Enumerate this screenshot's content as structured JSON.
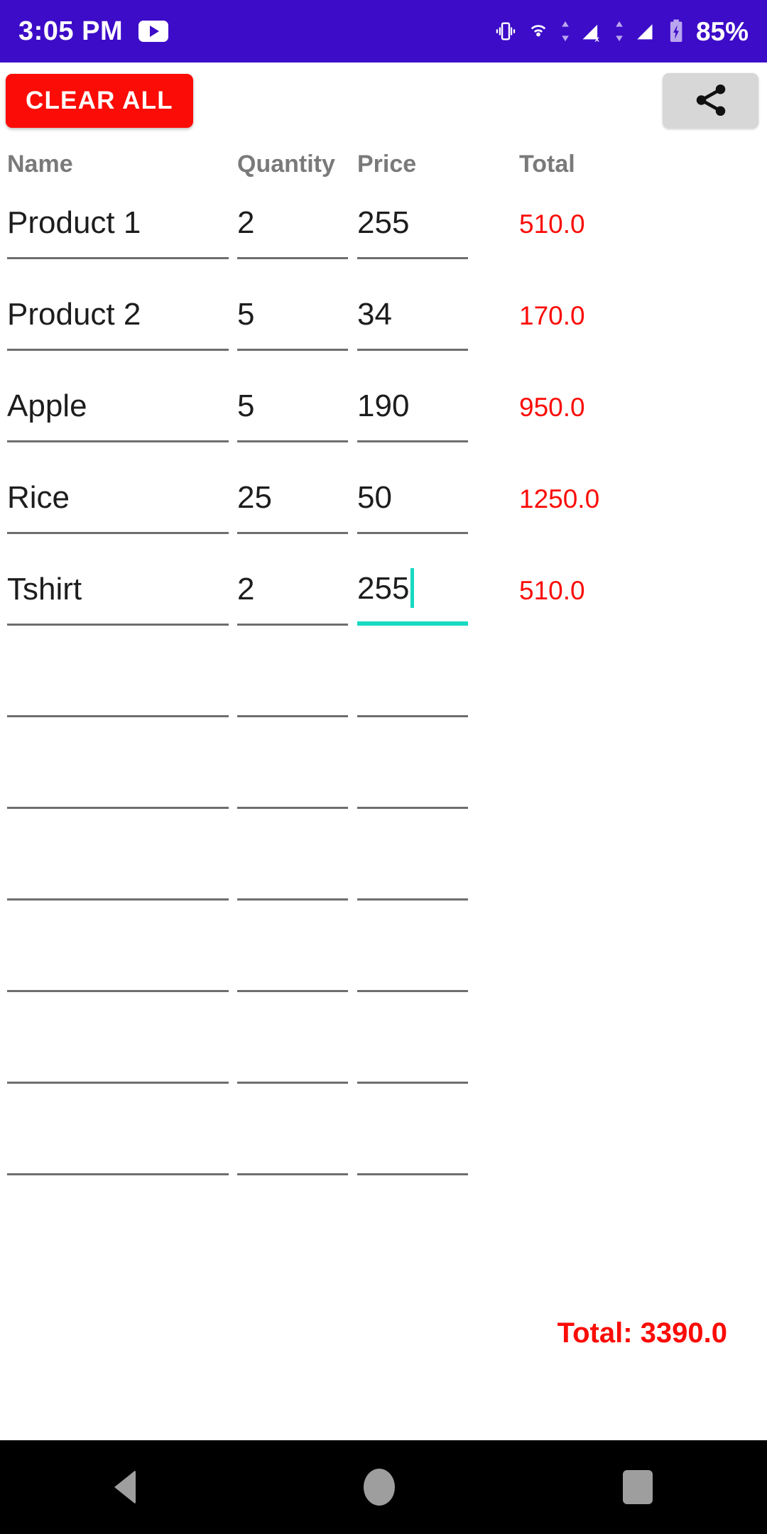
{
  "statusbar": {
    "time": "3:05 PM",
    "app_icon": "youtube-icon",
    "icons": [
      "vibrate-icon",
      "cast-icon",
      "data-transfer-icon",
      "signal-no-service-icon",
      "signal-bars-icon",
      "battery-charging-icon"
    ],
    "battery": "85%",
    "background_color": "#3d0cc8"
  },
  "toolbar": {
    "clear_label": "CLEAR ALL",
    "clear_color": "#fb0c06",
    "share_icon": "share-icon",
    "share_background": "#d7d7d7"
  },
  "table": {
    "headers": {
      "name": "Name",
      "quantity": "Quantity",
      "price": "Price",
      "total": "Total"
    },
    "header_color": "#7a7a7a",
    "total_color": "#fb0c06",
    "focus_color": "#18d9c2",
    "rows": [
      {
        "name": "Product 1",
        "quantity": "2",
        "price": "255",
        "total": "510.0",
        "focused": ""
      },
      {
        "name": "Product 2",
        "quantity": "5",
        "price": "34",
        "total": "170.0",
        "focused": ""
      },
      {
        "name": "Apple",
        "quantity": "5",
        "price": "190",
        "total": "950.0",
        "focused": ""
      },
      {
        "name": "Rice",
        "quantity": "25",
        "price": "50",
        "total": "1250.0",
        "focused": ""
      },
      {
        "name": "Tshirt",
        "quantity": "2",
        "price": "255",
        "total": "510.0",
        "focused": "price"
      },
      {
        "name": "",
        "quantity": "",
        "price": "",
        "total": "",
        "focused": ""
      },
      {
        "name": "",
        "quantity": "",
        "price": "",
        "total": "",
        "focused": ""
      },
      {
        "name": "",
        "quantity": "",
        "price": "",
        "total": "",
        "focused": ""
      },
      {
        "name": "",
        "quantity": "",
        "price": "",
        "total": "",
        "focused": ""
      },
      {
        "name": "",
        "quantity": "",
        "price": "",
        "total": "",
        "focused": ""
      },
      {
        "name": "",
        "quantity": "",
        "price": "",
        "total": "",
        "focused": ""
      }
    ]
  },
  "grand_total": {
    "label": "Total: 3390.0"
  },
  "navbar": {
    "back": "back-nav-icon",
    "home": "home-nav-icon",
    "recents": "recents-nav-icon"
  }
}
